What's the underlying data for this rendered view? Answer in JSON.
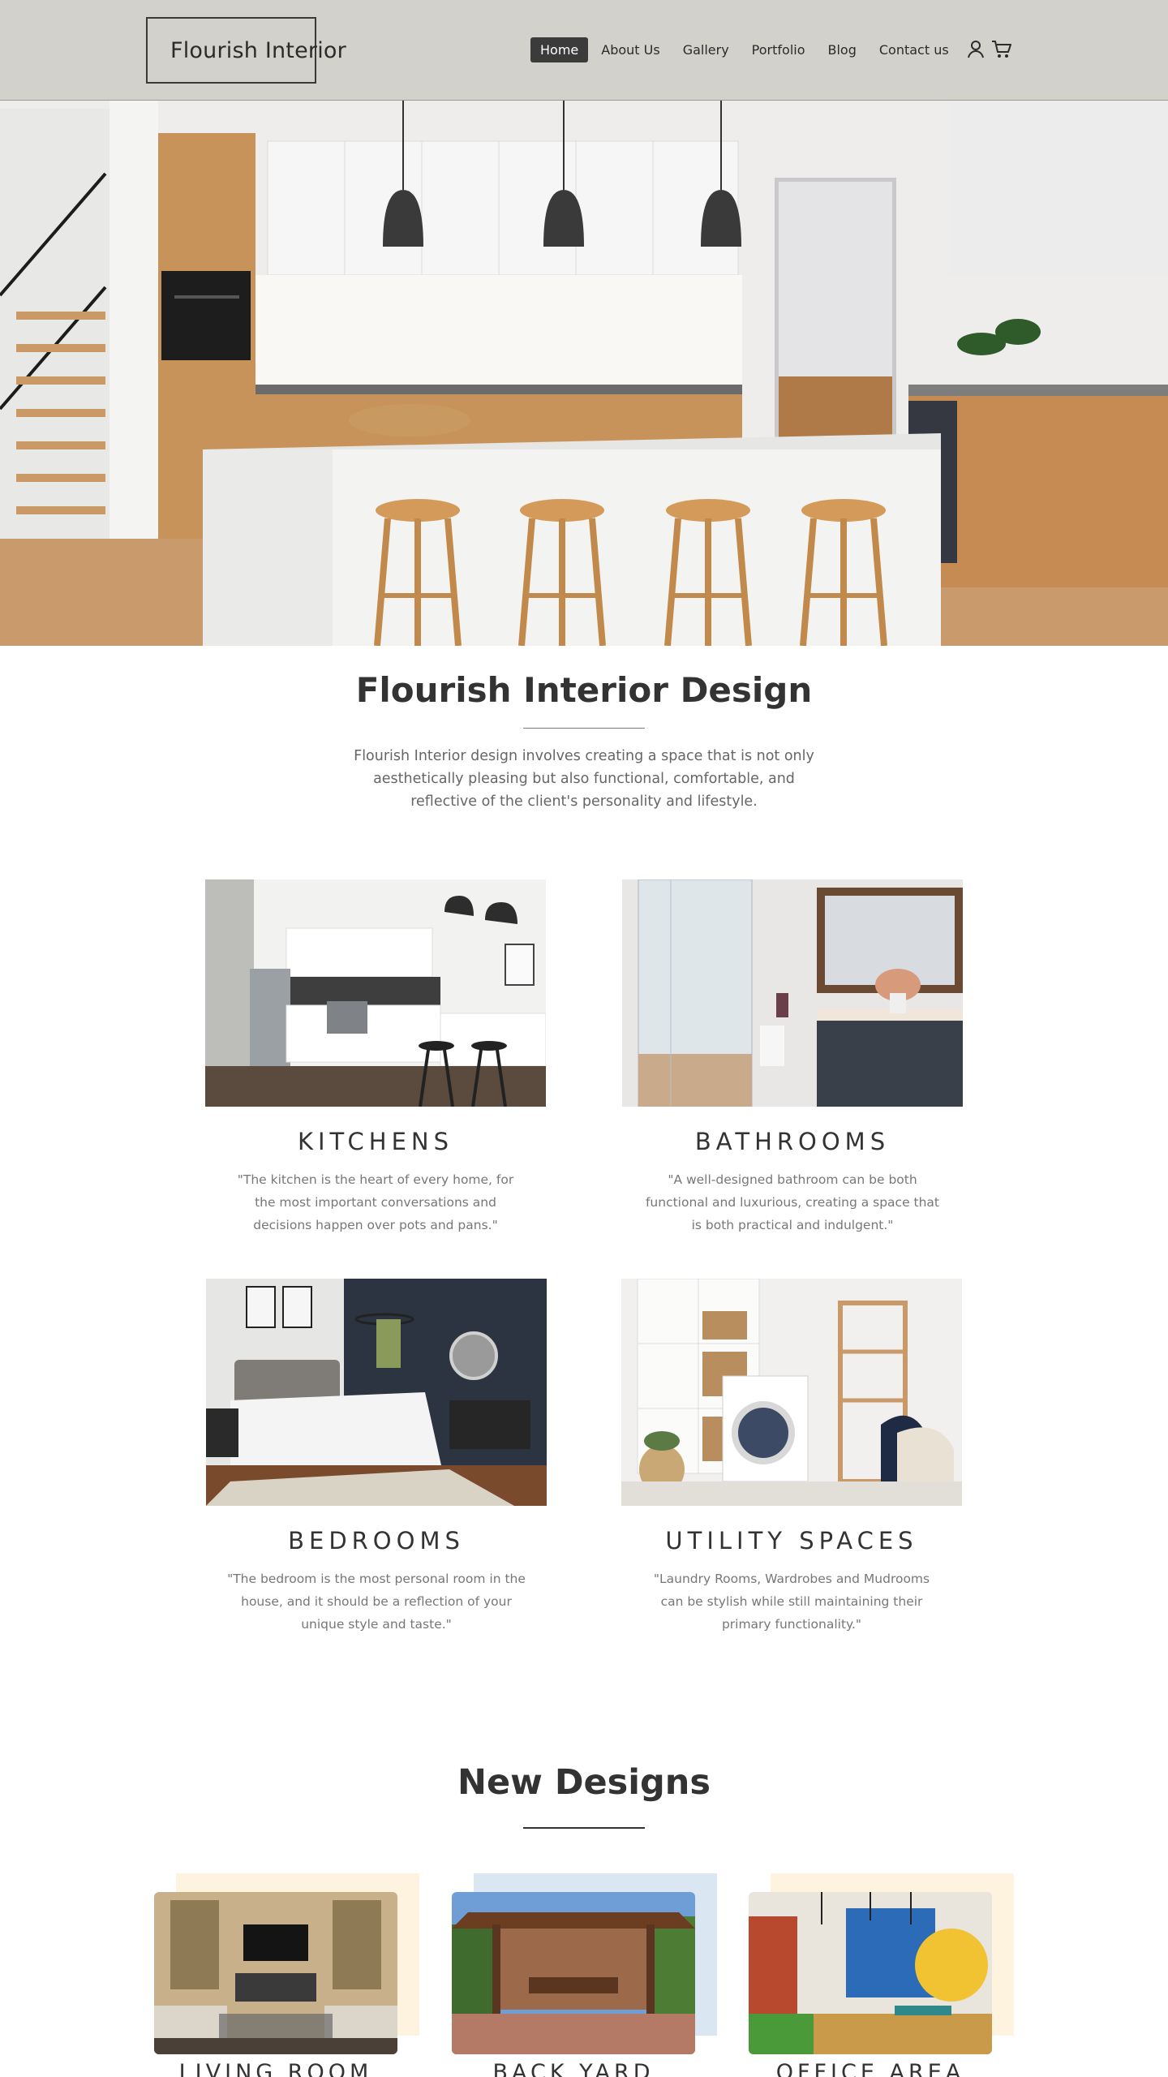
{
  "header": {
    "brand": "Flourish Interior",
    "nav": [
      "Home",
      "About Us",
      "Gallery",
      "Portfolio",
      "Blog",
      "Contact us"
    ],
    "active_nav": "Home",
    "icons": [
      "user-icon",
      "cart-icon"
    ]
  },
  "intro": {
    "title": "Flourish Interior Design",
    "text": "Flourish Interior design involves creating a space that is not only aesthetically pleasing but also functional, comfortable, and reflective of the client's personality and lifestyle."
  },
  "categories": [
    {
      "title": "KITCHENS",
      "quote": "\"The kitchen is the heart of every home, for the most important conversations and decisions happen over pots and pans.\""
    },
    {
      "title": "BATHROOMS",
      "quote": "\"A well-designed bathroom can be both functional and luxurious, creating a space that is both practical and indulgent.\""
    },
    {
      "title": "BEDROOMS",
      "quote": "\"The bedroom is the most personal room in the house, and it should be a reflection of your unique style and taste.\""
    },
    {
      "title": "UTILITY SPACES",
      "quote": "\"Laundry Rooms, Wardrobes and Mudrooms can be stylish while still maintaining their primary functionality.\""
    }
  ],
  "new_designs": {
    "title": "New Designs",
    "items": [
      {
        "label": "LIVING ROOM"
      },
      {
        "label": "BACK YARD"
      },
      {
        "label": "OFFICE AREA"
      }
    ]
  },
  "colors": {
    "header_bg": "#d3d1cc",
    "active_nav_bg": "#3b3b3b",
    "card_accent_warm": "#fdf3df",
    "card_accent_blue": "#dae6f2"
  }
}
